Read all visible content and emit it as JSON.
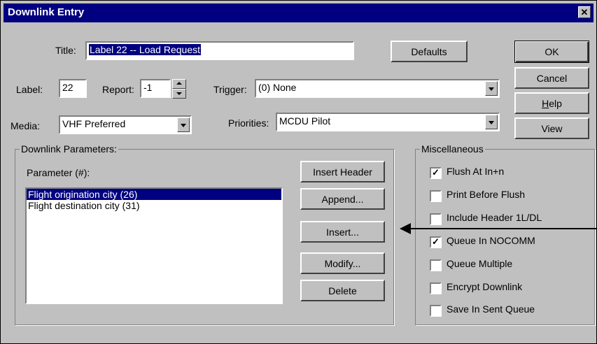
{
  "window": {
    "title": "Downlink Entry",
    "close_glyph": "✕"
  },
  "form": {
    "title_label": "Title:",
    "title_value": "Label 22 -- Load Request",
    "label_label": "Label:",
    "label_value": "22",
    "report_label": "Report:",
    "report_value": "-1",
    "trigger_label": "Trigger:",
    "trigger_value": "(0) None",
    "media_label": "Media:",
    "media_value": "VHF Preferred",
    "priorities_label": "Priorities:",
    "priorities_value": "MCDU Pilot"
  },
  "buttons": {
    "defaults": "Defaults",
    "ok": "OK",
    "cancel": "Cancel",
    "help_u": "H",
    "help_rest": "elp",
    "view": "View"
  },
  "downlink": {
    "group_title": "Downlink Parameters:",
    "parameter_label": "Parameter (#):",
    "items": [
      "Flight origination city (26)",
      "Flight destination city (31)"
    ],
    "selected_index": 0,
    "insert_header": "Insert Header",
    "append": "Append...",
    "insert": "Insert...",
    "modify": "Modify...",
    "delete": "Delete"
  },
  "misc": {
    "group_title": "Miscellaneous",
    "check_glyph": "✓",
    "options": [
      {
        "label": "Flush At In+n",
        "checked": true
      },
      {
        "label": "Print Before Flush",
        "checked": false
      },
      {
        "label": "Include Header 1L/DL",
        "checked": false
      },
      {
        "label": "Queue In NOCOMM",
        "checked": true
      },
      {
        "label": "Queue Multiple",
        "checked": false
      },
      {
        "label": "Encrypt Downlink",
        "checked": false
      },
      {
        "label": "Save In Sent Queue",
        "checked": false
      }
    ]
  },
  "colors": {
    "face": "#c0c0c0",
    "titlebar": "#000080",
    "selection": "#000080"
  }
}
